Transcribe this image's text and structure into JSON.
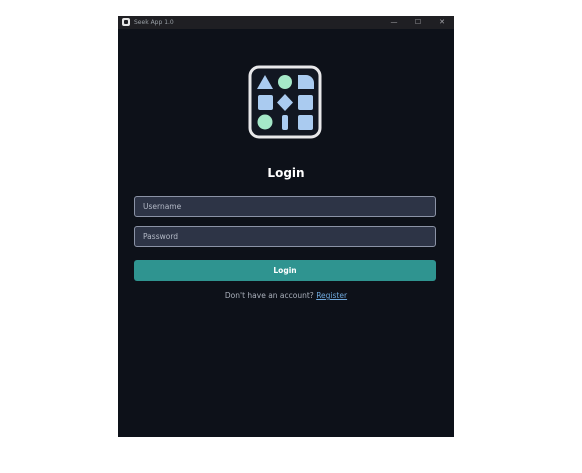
{
  "window": {
    "title": "Seek App 1.0",
    "minimize_glyph": "—",
    "maximize_glyph": "☐",
    "close_glyph": "✕"
  },
  "logo": {
    "icon": "app-logo-shapes-grid",
    "colors": {
      "blue": "#aacbf0",
      "mint": "#a5e8c8",
      "border": "#e8e8ea"
    }
  },
  "login": {
    "title": "Login",
    "username_placeholder": "Username",
    "username_value": "",
    "password_placeholder": "Password",
    "password_value": "",
    "button_label": "Login",
    "register_prompt": "Don't have an account? ",
    "register_link": "Register"
  },
  "colors": {
    "background": "#0d1119",
    "accent": "#2f9490",
    "field_bg": "#2d3446",
    "link": "#6fa8dc"
  }
}
